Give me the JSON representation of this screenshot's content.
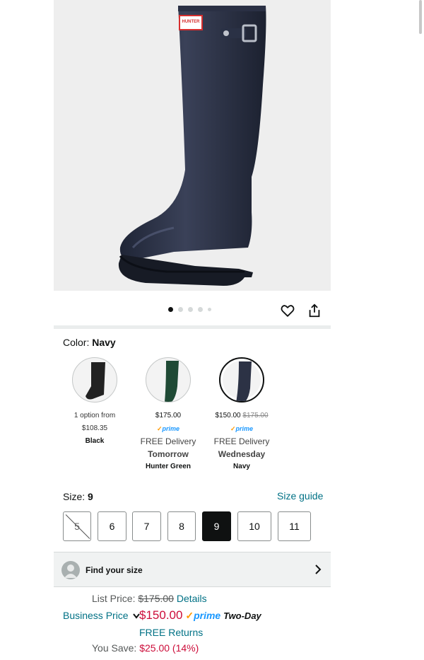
{
  "product": {
    "image_alt": "Navy tall rain boot",
    "logo_text": "HUNTER",
    "carousel": {
      "total": 5,
      "active": 1
    }
  },
  "actions": {
    "wishlist_icon": "heart-icon",
    "share_icon": "share-icon"
  },
  "color": {
    "label": "Color:",
    "selected": "Navy",
    "options": [
      {
        "line1": "1 option from",
        "line2": "$108.35",
        "prime": "",
        "delivery": "",
        "day": "",
        "name": "Black",
        "swatch": "#222222"
      },
      {
        "line1": "$175.00",
        "line1_strike": "",
        "line2": "",
        "prime": "prime",
        "delivery": "FREE Delivery",
        "day": "Tomorrow",
        "name": "Hunter Green",
        "swatch": "#1f4a35"
      },
      {
        "line1": "$150.00",
        "line1_strike": "$175.00",
        "line2": "",
        "prime": "prime",
        "delivery": "FREE Delivery",
        "day": "Wednesday",
        "name": "Navy",
        "swatch": "#2c3245"
      }
    ]
  },
  "size": {
    "label": "Size:",
    "selected": "9",
    "guide": "Size guide",
    "options": [
      "5",
      "6",
      "7",
      "8",
      "9",
      "10",
      "11"
    ]
  },
  "find_size": {
    "label": "Find your size"
  },
  "pricing": {
    "list_label": "List Price:",
    "list_price": "$175.00",
    "details": "Details",
    "business_label": "Business Price",
    "price": "$150.00",
    "prime": "prime",
    "two_day": "Two-Day",
    "free_returns": "FREE Returns",
    "save_label": "You Save:",
    "save_value": "$25.00 (14%)"
  },
  "colors": {
    "link": "#007185",
    "price_red": "#cc0c39",
    "prime_blue": "#1a98ff",
    "prime_orange": "#ff9900"
  }
}
